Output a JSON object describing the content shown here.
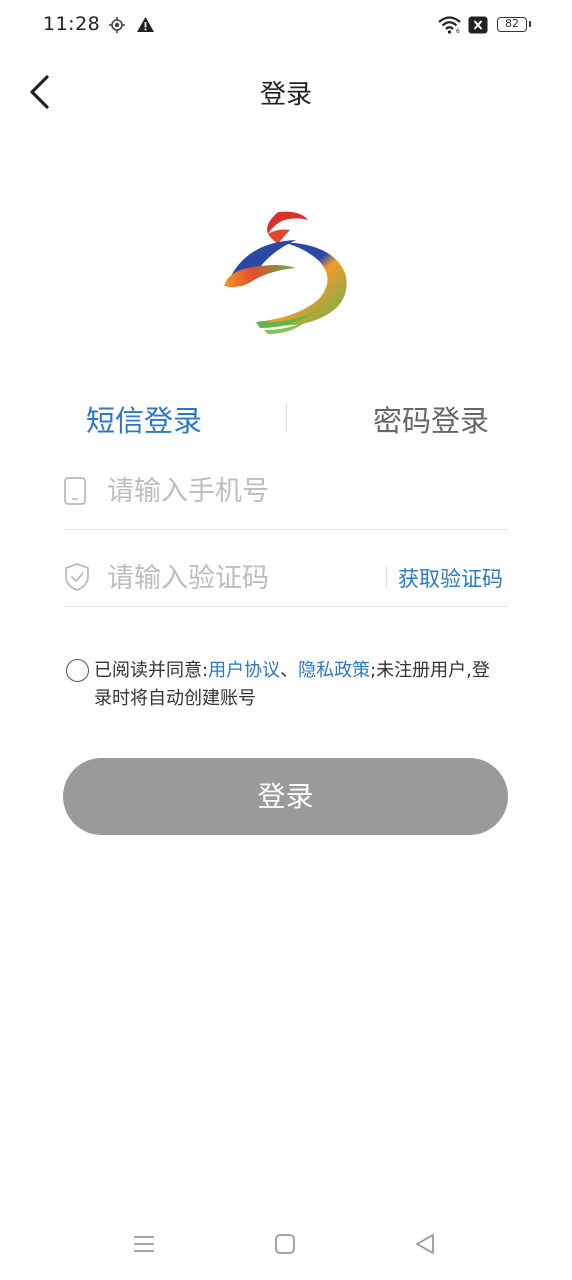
{
  "status_bar": {
    "time": "11:28",
    "battery": "82",
    "icons": [
      "location-icon",
      "warning-icon",
      "wifi-icon",
      "notification-x-icon",
      "battery-icon"
    ]
  },
  "header": {
    "title": "登录",
    "back_icon": "chevron-left-icon"
  },
  "logo": {
    "colors": [
      "#d8322c",
      "#2a48a8",
      "#f29a2e",
      "#5bb84a"
    ]
  },
  "tabs": {
    "sms_label": "短信登录",
    "password_label": "密码登录",
    "active": "sms",
    "active_color": "#2b78c5"
  },
  "form": {
    "phone": {
      "value": "",
      "placeholder": "请输入手机号",
      "icon": "phone-icon"
    },
    "code": {
      "value": "",
      "placeholder": "请输入验证码",
      "icon": "shield-check-icon",
      "get_code_label": "获取验证码"
    }
  },
  "agreement": {
    "prefix": "已阅读并同意:",
    "user_agreement": "用户协议",
    "separator": "、",
    "privacy_policy": "隐私政策",
    "suffix": ";未注册用户,登录时将自动创建账号",
    "checked": false
  },
  "login_button": {
    "label": "登录",
    "color": "#9a9a9a"
  },
  "nav_bar": {
    "icons": [
      "menu-icon",
      "home-square-icon",
      "back-triangle-icon"
    ]
  }
}
